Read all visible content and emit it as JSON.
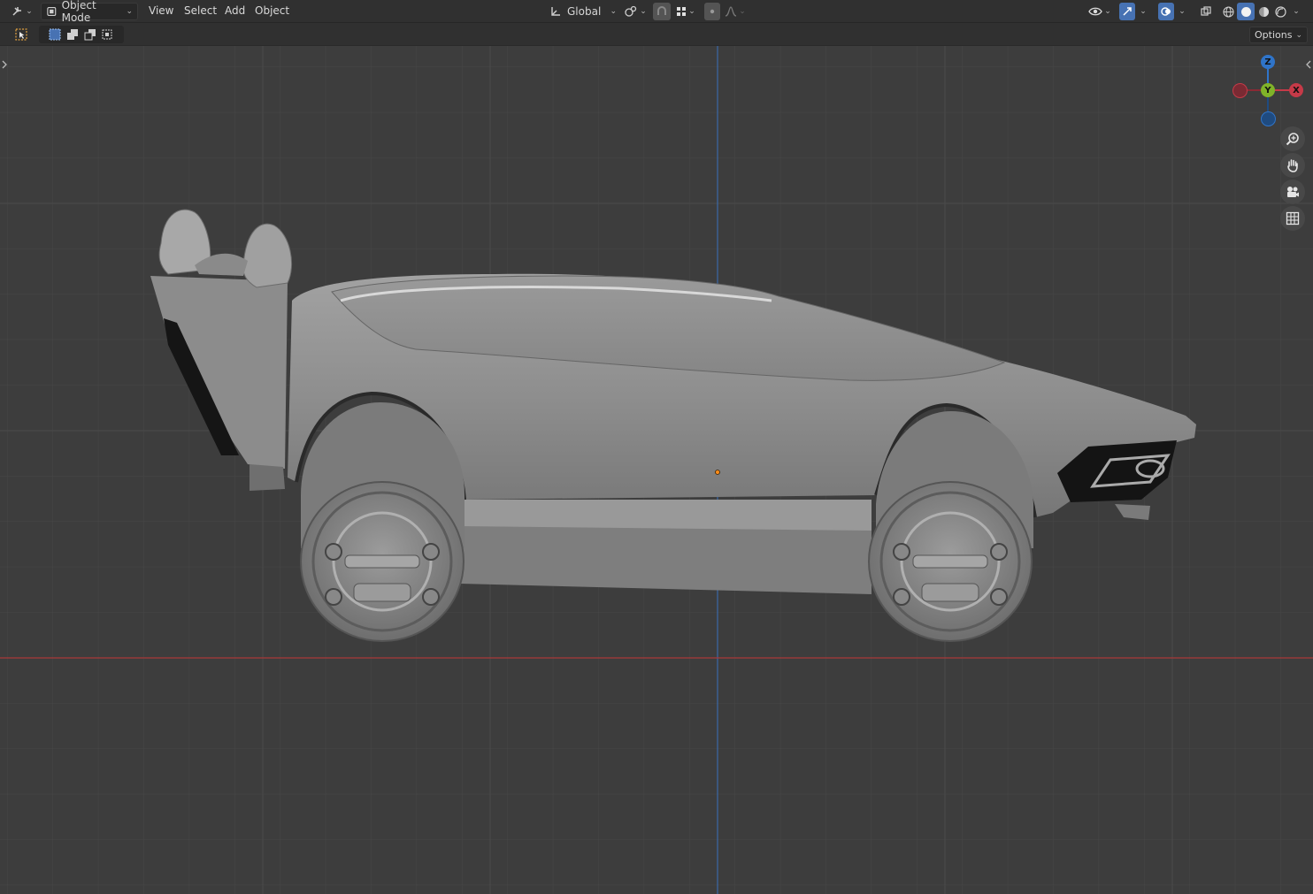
{
  "header": {
    "mode_label": "Object Mode",
    "menus": [
      "View",
      "Select",
      "Add",
      "Object"
    ],
    "orientation_label": "Global"
  },
  "toolbar": {
    "options_label": "Options"
  },
  "gizmo": {
    "z_label": "Z",
    "y_label": "Y",
    "x_label": "X"
  },
  "icons": {
    "editor_type": "editor-type-icon",
    "zoom": "zoom-icon",
    "pan": "hand-pan-icon",
    "camera": "camera-view-icon",
    "ortho": "grid-ortho-icon"
  },
  "colors": {
    "x_axis": "#c63a48",
    "y_axis": "#80b329",
    "z_axis": "#2f74c9",
    "accent": "#4772b3",
    "background": "#3d3d3d",
    "origin": "#ff8c1a"
  }
}
